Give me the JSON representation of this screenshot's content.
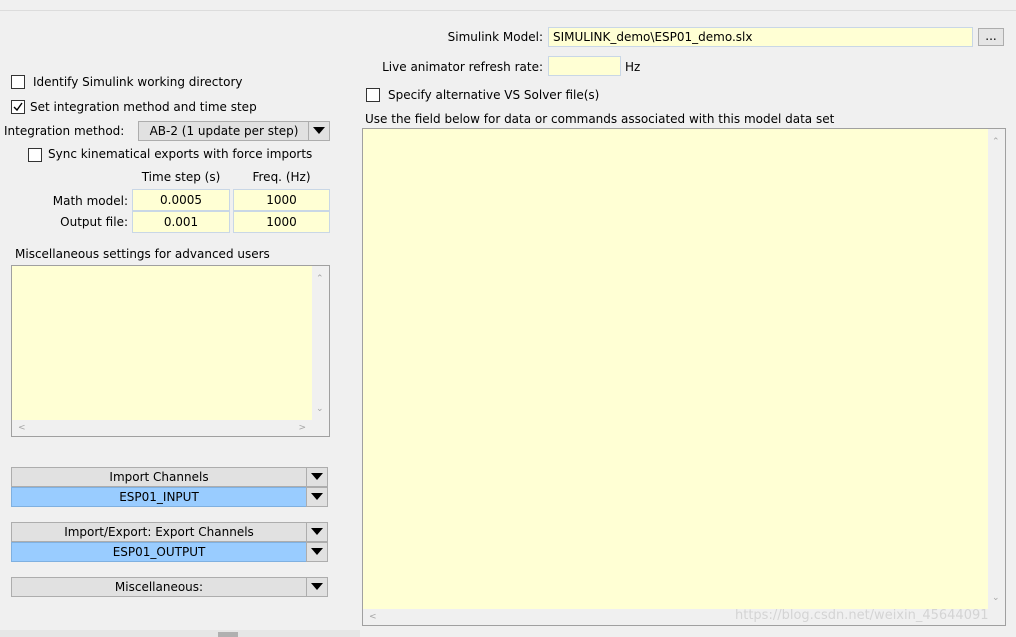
{
  "model": {
    "label": "Simulink Model:",
    "value": "SIMULINK_demo\\ESP01_demo.slx",
    "browse": "..."
  },
  "animator": {
    "label": "Live animator refresh rate:",
    "value": "",
    "unit": "Hz"
  },
  "alt_solver": {
    "label": "Specify alternative VS Solver file(s)",
    "checked": false
  },
  "data_field_label": "Use the field below  for data or commands associated with this model data set",
  "identify_dir": {
    "label": "Identify Simulink working directory",
    "checked": false
  },
  "set_integration": {
    "label": "Set integration method and time step",
    "checked": true
  },
  "integration": {
    "label": "Integration method:",
    "value": "AB-2 (1 update per step)"
  },
  "sync": {
    "label": "Sync kinematical exports with force imports",
    "checked": false
  },
  "timestep_table": {
    "headers": [
      "Time step (s)",
      "Freq. (Hz)"
    ],
    "rows": [
      {
        "label": "Math model:",
        "time_step": "0.0005",
        "freq": "1000"
      },
      {
        "label": "Output file:",
        "time_step": "0.001",
        "freq": "1000"
      }
    ]
  },
  "misc_settings_label": "Miscellaneous settings for advanced users",
  "import_channels": {
    "label": "Import Channels",
    "value": "ESP01_INPUT"
  },
  "export_channels": {
    "label": "Import/Export: Export Channels",
    "value": "ESP01_OUTPUT"
  },
  "miscellaneous": {
    "label": "Miscellaneous:"
  },
  "watermark": "https://blog.csdn.net/weixin_45644091",
  "colors": {
    "field_bg": "#ffffd4",
    "selected_channel_bg": "#99ccff",
    "window_bg": "#f0f0f0"
  }
}
